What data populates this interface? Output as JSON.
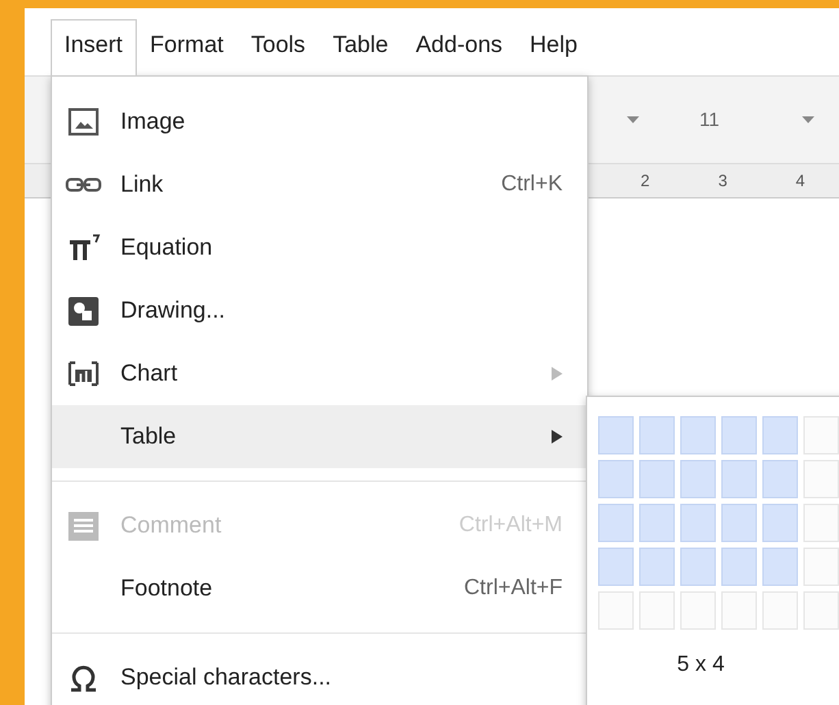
{
  "menubar": [
    {
      "label": "Insert",
      "selected": true
    },
    {
      "label": "Format",
      "selected": false
    },
    {
      "label": "Tools",
      "selected": false
    },
    {
      "label": "Table",
      "selected": false
    },
    {
      "label": "Add-ons",
      "selected": false
    },
    {
      "label": "Help",
      "selected": false
    }
  ],
  "toolbar": {
    "font_size": "11"
  },
  "ruler": [
    "2",
    "3",
    "4"
  ],
  "insert_menu": [
    {
      "kind": "image",
      "label": "Image",
      "selected": false,
      "disabled": false
    },
    {
      "kind": "link",
      "label": "Link",
      "shortcut": "Ctrl+K",
      "selected": false,
      "disabled": false
    },
    {
      "kind": "equation",
      "label": "Equation",
      "selected": false,
      "disabled": false
    },
    {
      "kind": "drawing",
      "label": "Drawing...",
      "selected": false,
      "disabled": false
    },
    {
      "kind": "chart",
      "label": "Chart",
      "submenu": true,
      "selected": false,
      "disabled": false
    },
    {
      "kind": "plain",
      "label": "Table",
      "submenu": true,
      "selected": true,
      "disabled": false
    },
    {
      "kind": "separator"
    },
    {
      "kind": "comment",
      "label": "Comment",
      "shortcut": "Ctrl+Alt+M",
      "selected": false,
      "disabled": true
    },
    {
      "kind": "plain",
      "label": "Footnote",
      "shortcut": "Ctrl+Alt+F",
      "selected": false,
      "disabled": false
    },
    {
      "kind": "separator"
    },
    {
      "kind": "special",
      "label": "Special characters...",
      "selected": false,
      "disabled": false
    }
  ],
  "table_picker": {
    "grid": [
      [
        {
          "selected": true
        },
        {
          "selected": true
        },
        {
          "selected": true
        },
        {
          "selected": true
        },
        {
          "selected": true
        },
        {
          "selected": false
        }
      ],
      [
        {
          "selected": true
        },
        {
          "selected": true
        },
        {
          "selected": true
        },
        {
          "selected": true
        },
        {
          "selected": true
        },
        {
          "selected": false
        }
      ],
      [
        {
          "selected": true
        },
        {
          "selected": true
        },
        {
          "selected": true
        },
        {
          "selected": true
        },
        {
          "selected": true
        },
        {
          "selected": false
        }
      ],
      [
        {
          "selected": true
        },
        {
          "selected": true
        },
        {
          "selected": true
        },
        {
          "selected": true
        },
        {
          "selected": true
        },
        {
          "selected": false
        }
      ],
      [
        {
          "selected": false
        },
        {
          "selected": false
        },
        {
          "selected": false
        },
        {
          "selected": false
        },
        {
          "selected": false
        },
        {
          "selected": false
        }
      ]
    ],
    "size_label": "5 x 4"
  }
}
